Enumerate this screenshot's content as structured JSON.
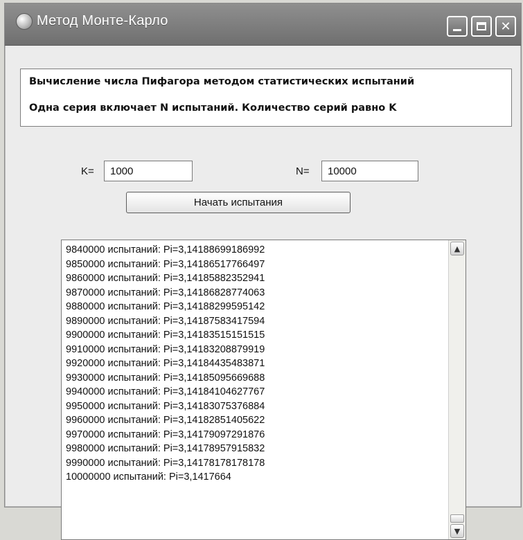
{
  "window": {
    "title": "Метод Монте-Карло",
    "controls": {
      "minimize": "minimize-icon",
      "maximize": "maximize-icon",
      "close": "close-icon"
    }
  },
  "info": {
    "line1": "Вычисление числа Пифагора методом статистических испытаний",
    "line2": "Одна серия включает N  испытаний.  Количество серий равно K"
  },
  "inputs": {
    "k_label": "K=",
    "k_value": "1000",
    "n_label": "N=",
    "n_value": "10000"
  },
  "start_button": "Начать испытания",
  "results": [
    "9840000 испытаний:  Pi=3,14188699186992",
    "9850000 испытаний:  Pi=3,14186517766497",
    "9860000 испытаний:  Pi=3,14185882352941",
    "9870000 испытаний:  Pi=3,14186828774063",
    "9880000 испытаний:  Pi=3,14188299595142",
    "9890000 испытаний:  Pi=3,14187583417594",
    "9900000 испытаний:  Pi=3,14183515151515",
    "9910000 испытаний:  Pi=3,14183208879919",
    "9920000 испытаний:  Pi=3,14184435483871",
    "9930000 испытаний:  Pi=3,14185095669688",
    "9940000 испытаний:  Pi=3,14184104627767",
    "9950000 испытаний:  Pi=3,14183075376884",
    "9960000 испытаний:  Pi=3,14182851405622",
    "9970000 испытаний:  Pi=3,14179097291876",
    "9980000 испытаний:  Pi=3,14178957915832",
    "9990000 испытаний:  Pi=3,14178178178178",
    "10000000 испытаний:  Pi=3,1417664"
  ],
  "scrollbar": {
    "up": "chevron-up-icon",
    "down": "chevron-down-icon"
  },
  "colors": {
    "titlebar": "#7a7a7a",
    "window_bg": "#ececec",
    "panel_bg": "#ffffff"
  }
}
